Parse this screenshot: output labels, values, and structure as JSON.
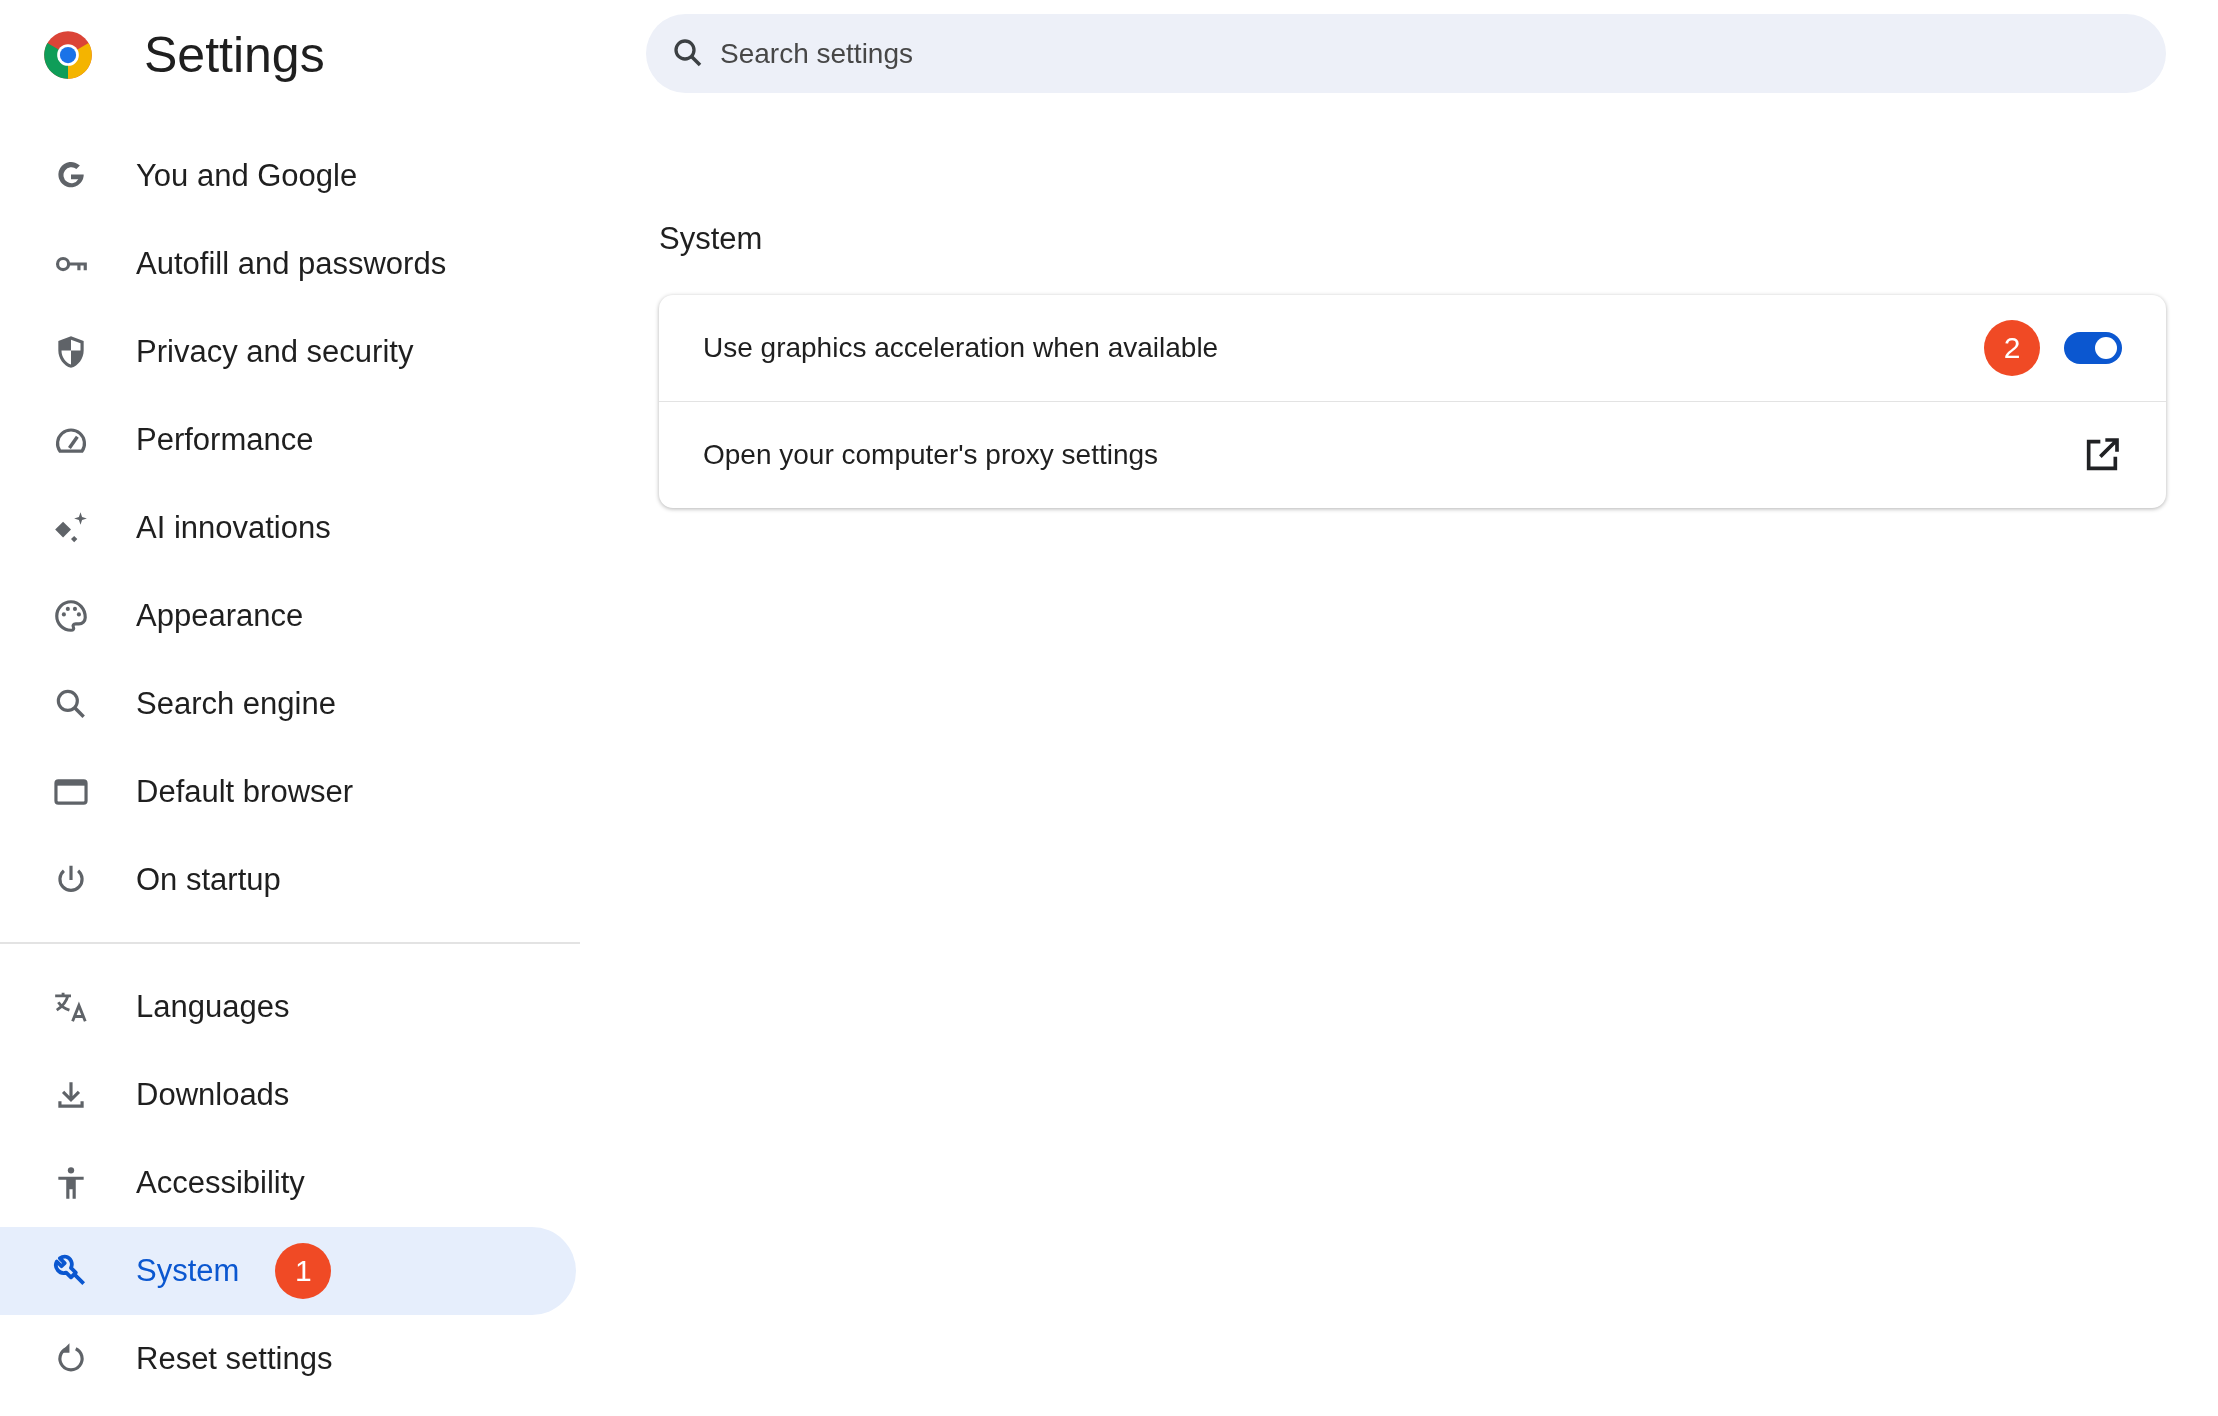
{
  "header": {
    "title": "Settings"
  },
  "search": {
    "placeholder": "Search settings"
  },
  "sidebar": {
    "sections": [
      {
        "items": [
          {
            "label": "You and Google",
            "selected": false
          },
          {
            "label": "Autofill and passwords",
            "selected": false
          },
          {
            "label": "Privacy and security",
            "selected": false
          },
          {
            "label": "Performance",
            "selected": false
          },
          {
            "label": "AI innovations",
            "selected": false
          },
          {
            "label": "Appearance",
            "selected": false
          },
          {
            "label": "Search engine",
            "selected": false
          },
          {
            "label": "Default browser",
            "selected": false
          },
          {
            "label": "On startup",
            "selected": false
          }
        ]
      },
      {
        "items": [
          {
            "label": "Languages",
            "selected": false
          },
          {
            "label": "Downloads",
            "selected": false
          },
          {
            "label": "Accessibility",
            "selected": false
          },
          {
            "label": "System",
            "selected": true,
            "badge": "1"
          },
          {
            "label": "Reset settings",
            "selected": false
          }
        ]
      }
    ]
  },
  "section": {
    "title": "System",
    "rows": [
      {
        "kind": "toggle",
        "label": "Use graphics acceleration when available",
        "badge": "2",
        "on": true
      },
      {
        "kind": "link",
        "label": "Open your computer's proxy settings"
      }
    ]
  }
}
